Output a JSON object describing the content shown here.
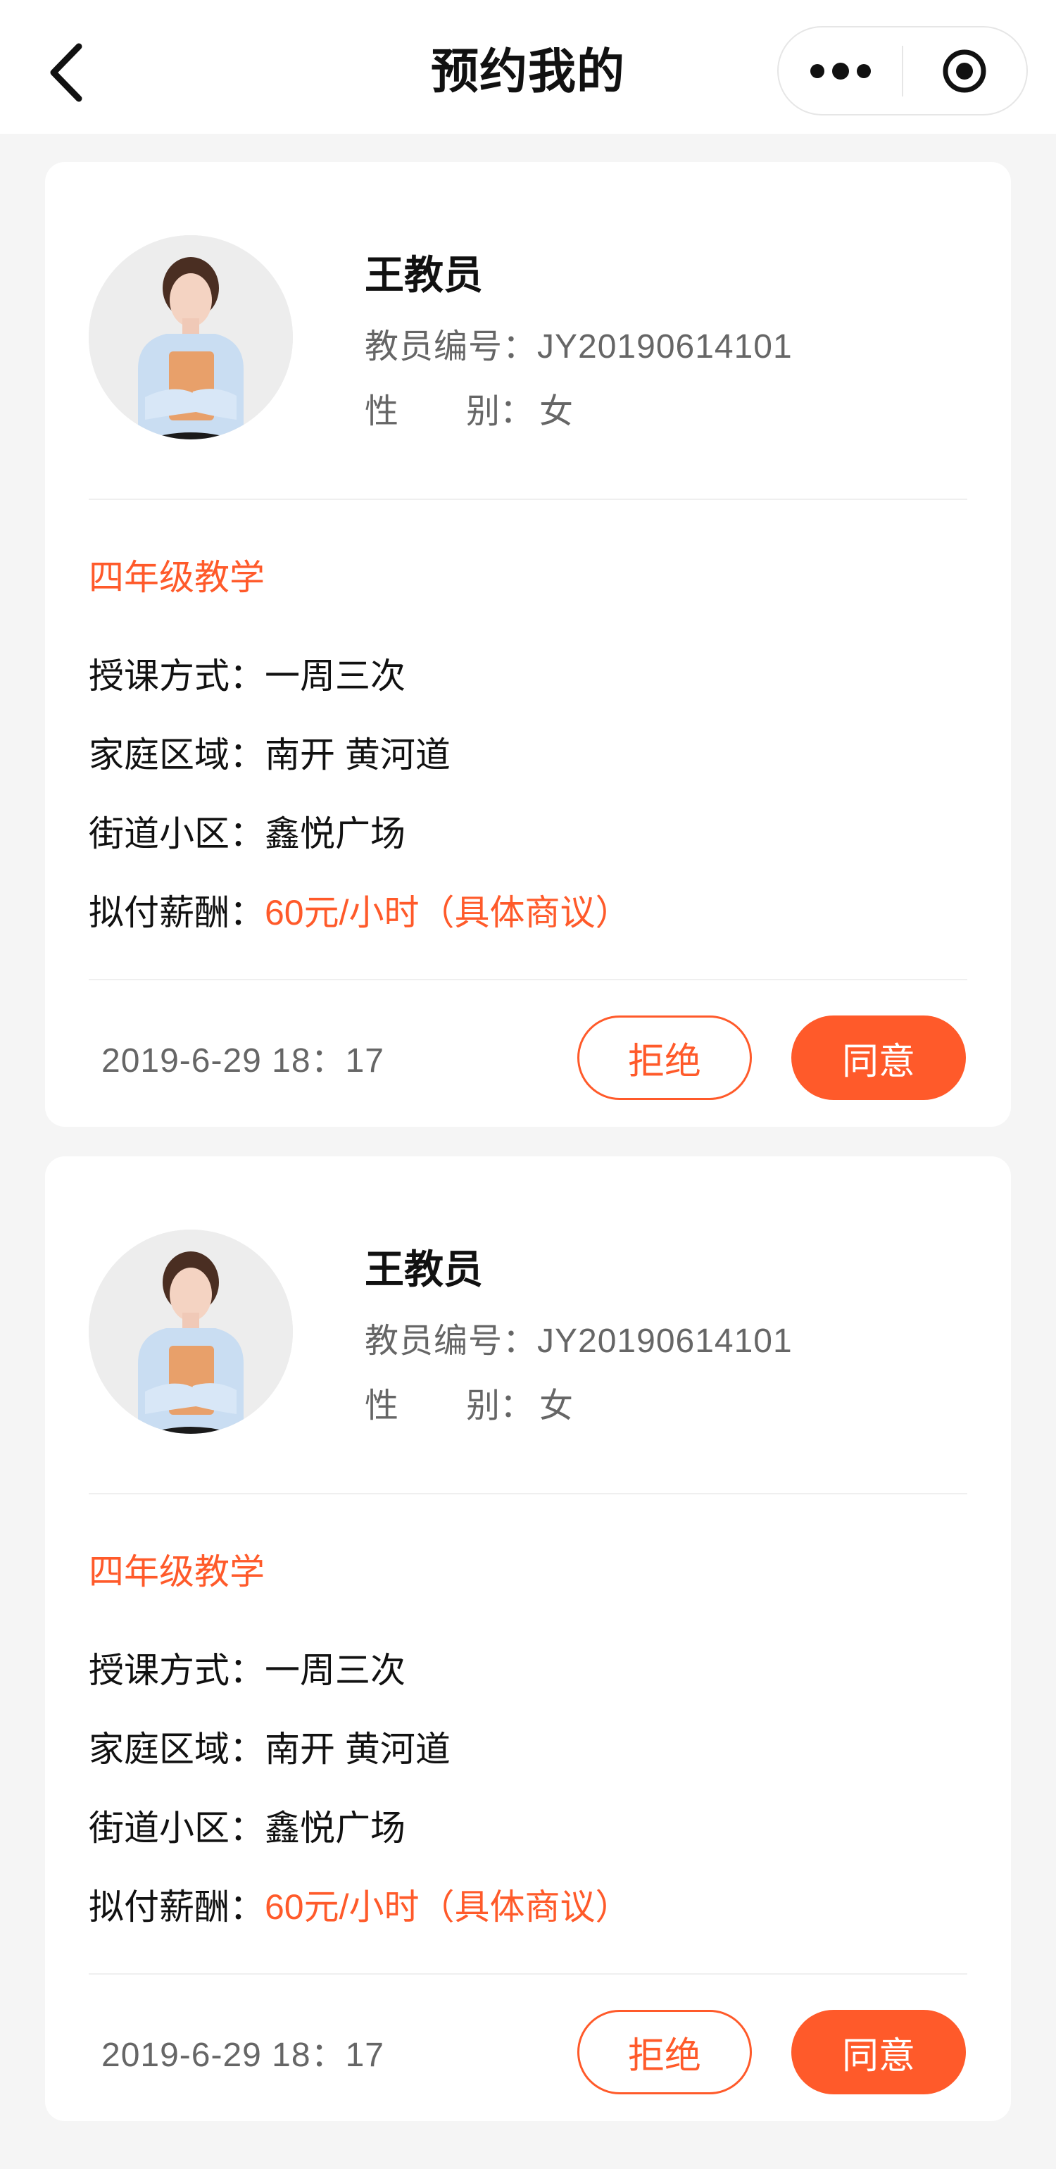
{
  "header": {
    "title": "预约我的",
    "icons": {
      "back": "chevron-left-icon",
      "more": "more-dots-icon",
      "close": "target-icon"
    }
  },
  "colors": {
    "accent": "#FF5A2A",
    "background": "#F5F5F5",
    "card": "#FFFFFF"
  },
  "cards": [
    {
      "name": "王教员",
      "id_label": "教员编号：",
      "id_value": "JY20190614101",
      "gender_label": "性　　别：",
      "gender_value": "女",
      "subject": "四年级教学",
      "fields": [
        {
          "label": "授课方式：",
          "value": "一周三次"
        },
        {
          "label": "家庭区域：",
          "value": "南开 黄河道"
        },
        {
          "label": "街道小区：",
          "value": "鑫悦广场"
        },
        {
          "label": "拟付薪酬：",
          "value": "60元/小时（具体商议）"
        }
      ],
      "time": "2019-6-29  18：17",
      "reject_label": "拒绝",
      "agree_label": "同意"
    },
    {
      "name": "王教员",
      "id_label": "教员编号：",
      "id_value": "JY20190614101",
      "gender_label": "性　　别：",
      "gender_value": "女",
      "subject": "四年级教学",
      "fields": [
        {
          "label": "授课方式：",
          "value": "一周三次"
        },
        {
          "label": "家庭区域：",
          "value": "南开 黄河道"
        },
        {
          "label": "街道小区：",
          "value": "鑫悦广场"
        },
        {
          "label": "拟付薪酬：",
          "value": "60元/小时（具体商议）"
        }
      ],
      "time": "2019-6-29  18：17",
      "reject_label": "拒绝",
      "agree_label": "同意"
    }
  ]
}
